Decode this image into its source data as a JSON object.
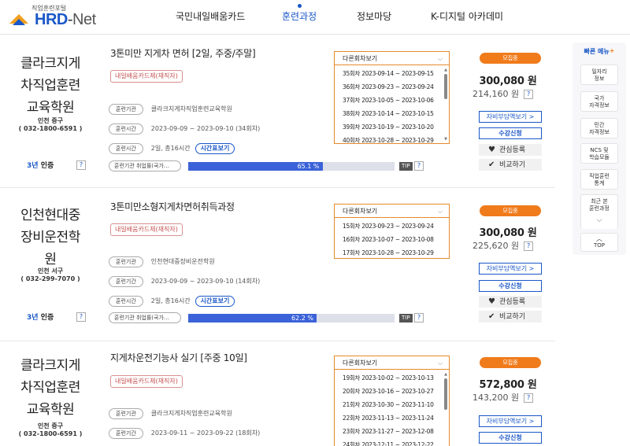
{
  "logo": {
    "sub": "직업훈련포털",
    "main_a": "HRD",
    "main_b": "-",
    "main_c": "Net"
  },
  "nav": [
    {
      "label": "국민내일배움카드"
    },
    {
      "label": "훈련과정"
    },
    {
      "label": "정보마당"
    },
    {
      "label": "K-디지털 아카데미"
    }
  ],
  "courses": [
    {
      "org_name": "클라크지게차직업훈련교육학원",
      "org_line1": "클라크지게",
      "org_line2": "차직업훈련",
      "org_line3": "교육학원",
      "location": "인천 중구",
      "phone": "( 032-1800-6591 )",
      "cert_num": "3년",
      "cert_label": "인증",
      "title": "3톤미만 지게차 면허 [2일, 주중/주말]",
      "tag": "내일배움카드제(재직자)",
      "label_org": "훈련기관",
      "val_org": "클라크지게차직업훈련교육학원",
      "label_period": "훈련시간",
      "val_period": "2023-09-09 ~ 2023-09-10 (34회차)",
      "label_hours": "훈련시간",
      "val_hours": "2일, 총16시간",
      "time_btn": "시간표보기",
      "rate_label": "훈련기관 취업률(국가…",
      "rate_value": 65.1,
      "rate_text": "65.1 %",
      "tip": "TIP",
      "rounds_label": "다른회차보기",
      "rounds": [
        "35회차 2023-09-14 ~ 2023-09-15",
        "36회차 2023-09-23 ~ 2023-09-24",
        "37회차 2023-10-05 ~ 2023-10-06",
        "38회차 2023-10-14 ~ 2023-10-15",
        "39회차 2023-10-19 ~ 2023-10-20",
        "40회차 2023-10-28 ~ 2023-10-29"
      ],
      "status": "모집중",
      "price": "300,080 원",
      "price_sub": "214,160 원",
      "btn_support": "자비부담액보기 >",
      "btn_apply": "수강신청",
      "btn_like": "관심등록",
      "btn_compare": "비교하기"
    },
    {
      "org_line1": "인천현대중",
      "org_line2": "장비운전학",
      "org_line3": "원",
      "location": "인천 서구",
      "phone": "( 032-299-7070 )",
      "cert_num": "3년",
      "cert_label": "인증",
      "title": "3톤미만소형지게차면허취득과정",
      "tag": "내일배움카드제(재직자)",
      "label_org": "훈련기관",
      "val_org": "인천현대중장비운전학원",
      "label_period": "훈련기간",
      "val_period": "2023-09-09 ~ 2023-09-10 (14회차)",
      "label_hours": "훈련시간",
      "val_hours": "2일, 총16시간",
      "time_btn": "시간표보기",
      "rate_label": "훈련기관 취업률(국가…",
      "rate_value": 62.2,
      "rate_text": "62.2 %",
      "tip": "TIP",
      "rounds_label": "다른회차보기",
      "rounds": [
        "15회차 2023-09-23 ~ 2023-09-24",
        "16회차 2023-10-07 ~ 2023-10-08",
        "17회차 2023-10-28 ~ 2023-10-29"
      ],
      "status": "모집중",
      "price": "300,080 원",
      "price_sub": "225,620 원",
      "btn_support": "자비부담액보기 >",
      "btn_apply": "수강신청",
      "btn_like": "관심등록",
      "btn_compare": "비교하기"
    },
    {
      "org_line1": "클라크지게",
      "org_line2": "차직업훈련",
      "org_line3": "교육학원",
      "location": "인천 중구",
      "phone": "( 032-1800-6591 )",
      "title": "지게차운전기능사 실기 [주중 10일]",
      "tag": "내일배움카드제(재직자)",
      "label_org": "훈련기관",
      "val_org": "클라크지게차직업훈련교육학원",
      "label_period": "훈련기간",
      "val_period": "2023-09-11 ~ 2023-09-22 (18회차)",
      "rounds_label": "다른회차보기",
      "rounds": [
        "19회차 2023-10-02 ~ 2023-10-13",
        "20회차 2023-10-16 ~ 2023-10-27",
        "21회차 2023-10-30 ~ 2023-11-10",
        "22회차 2023-11-13 ~ 2023-11-24",
        "23회차 2023-11-27 ~ 2023-12-08",
        "24회차 2023-12-11 ~ 2023-12-22"
      ],
      "status": "모집중",
      "price": "572,800 원",
      "price_sub": "143,200 원",
      "btn_support": "자비부담액보기 >",
      "btn_apply": "수강신청"
    }
  ],
  "help_q": "?",
  "quick_menu": {
    "title": "빠른 메뉴",
    "items": [
      {
        "l1": "일자리",
        "l2": "정보"
      },
      {
        "l1": "국가",
        "l2": "자격정보"
      },
      {
        "l1": "민간",
        "l2": "자격정보"
      },
      {
        "l1": "NCS 및",
        "l2": "학습모듈"
      },
      {
        "l1": "직업훈련",
        "l2": "통계"
      },
      {
        "l1": "최근 본",
        "l2": "훈련과정"
      }
    ],
    "top": "TOP"
  }
}
